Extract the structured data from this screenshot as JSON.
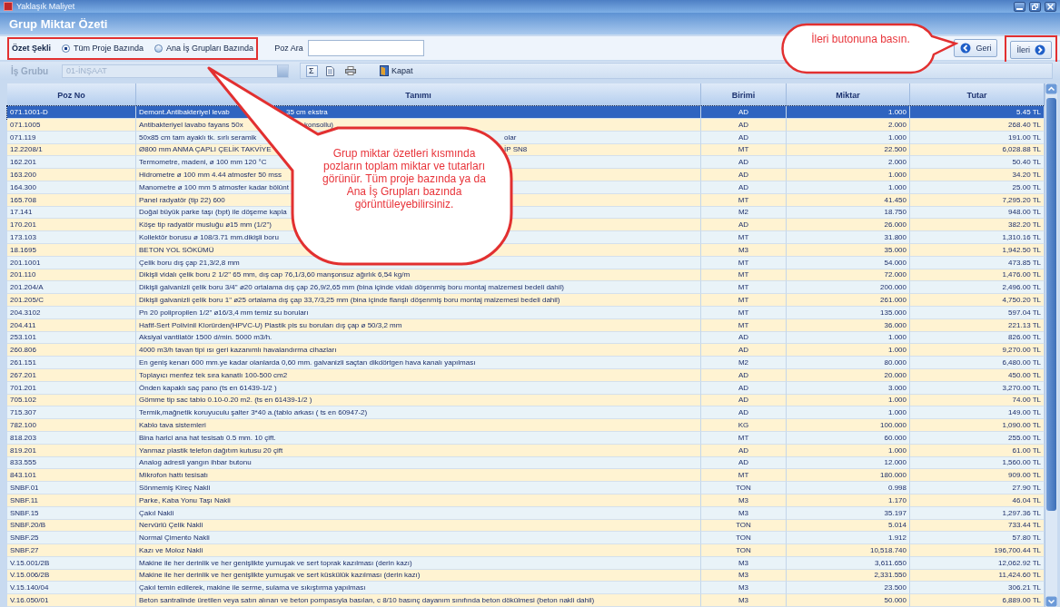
{
  "window": {
    "title": "Yaklaşık Maliyet"
  },
  "page_title": "Grup Miktar Özeti",
  "summary_mode": {
    "label": "Özet Şekli",
    "options": [
      {
        "label": "Tüm Proje Bazında",
        "selected": true
      },
      {
        "label": "Ana İş Grupları Bazında",
        "selected": false
      }
    ]
  },
  "search": {
    "label": "Poz Ara"
  },
  "nav_buttons": [
    {
      "label": "Geri",
      "kind": "back"
    },
    {
      "label": "İleri",
      "kind": "next"
    }
  ],
  "work_group": {
    "label": "İş Grubu",
    "value": "01-İNŞAAT",
    "disabled": true
  },
  "toolbar": [
    {
      "kind": "sum",
      "label": "Σ"
    },
    {
      "kind": "document"
    },
    {
      "kind": "print"
    },
    {
      "kind": "close",
      "label": "Kapat"
    }
  ],
  "table": {
    "columns": [
      "Poz No",
      "Tanımı",
      "Birimi",
      "Miktar",
      "Tutar"
    ],
    "rows": [
      {
        "poz": "071.1001-D",
        "desc": "Demont.Antibakteriyel levab",
        "desc_tail": "35 cm ekstra",
        "unit": "AD",
        "qty": "1.000",
        "amount": "5.45 TL",
        "selected": true
      },
      {
        "poz": "071.1005",
        "desc": "Antibakteriyel lavabo fayans 50x",
        "desc_tail": "konsollu)",
        "unit": "AD",
        "qty": "2.000",
        "amount": "268.40 TL",
        "selected": false
      },
      {
        "poz": "071.119",
        "desc": "50x85 cm tam ayaklı tk. sırlı seramik",
        "desc_tail": "olar",
        "unit": "AD",
        "qty": "1.000",
        "amount": "191.00 TL",
        "selected": false
      },
      {
        "poz": "12.2208/1",
        "desc": "Ø800 mm ANMA ÇAPLI ÇELİK TAKVİYE",
        "desc_tail": "İP SN8",
        "unit": "MT",
        "qty": "22.500",
        "amount": "6,028.88 TL",
        "selected": false
      },
      {
        "poz": "162.201",
        "desc": "Termometre, madeni, ø 100 mm 120 °C",
        "unit": "AD",
        "qty": "2.000",
        "amount": "50.40 TL",
        "selected": false
      },
      {
        "poz": "163.200",
        "desc": "Hidrometre ø 100 mm 4.44 atmosfer 50 mss",
        "unit": "AD",
        "qty": "1.000",
        "amount": "34.20 TL",
        "selected": false
      },
      {
        "poz": "164.300",
        "desc": "Manometre ø 100 mm 5 atmosfer kadar bölünt",
        "unit": "AD",
        "qty": "1.000",
        "amount": "25.00 TL",
        "selected": false
      },
      {
        "poz": "165.708",
        "desc": "Panel radyatör (tip 22) 600",
        "unit": "MT",
        "qty": "41.450",
        "amount": "7,295.20 TL",
        "selected": false
      },
      {
        "poz": "17.141",
        "desc": "Doğal büyük parke taşı (bpt) ile döşeme kapla",
        "unit": "M2",
        "qty": "18.750",
        "amount": "948.00 TL",
        "selected": false
      },
      {
        "poz": "170.201",
        "desc": "Köşe tip radyatör musluğu  ø15 mm (1/2\")",
        "unit": "AD",
        "qty": "26.000",
        "amount": "382.20 TL",
        "selected": false
      },
      {
        "poz": "173.103",
        "desc": "Kollektör borusu ø 108/3.71 mm.dikişli boru",
        "unit": "MT",
        "qty": "31.800",
        "amount": "1,310.16 TL",
        "selected": false
      },
      {
        "poz": "18.1695",
        "desc": "BETON YOL SÖKÜMÜ",
        "unit": "M3",
        "qty": "35.000",
        "amount": "1,942.50 TL",
        "selected": false
      },
      {
        "poz": "201.1001",
        "desc": "Çelik boru dış çap 21,3/2,8 mm",
        "unit": "MT",
        "qty": "54.000",
        "amount": "473.85 TL",
        "selected": false
      },
      {
        "poz": "201.110",
        "desc": "Dikişli vidalı çelik boru 2 1/2\" 65 mm, dış cap 76,1/3,60 manşonsuz ağırlık 6,54 kg/m",
        "unit": "MT",
        "qty": "72.000",
        "amount": "1,476.00 TL",
        "selected": false
      },
      {
        "poz": "201.204/A",
        "desc": "Dikişli galvanizli çelik boru 3/4\"  ø20 ortalama dış çap 26,9/2,65 mm  (bina içinde vidalı döşenmiş boru montaj malzemesi bedeli dahil)",
        "unit": "MT",
        "qty": "200.000",
        "amount": "2,496.00 TL",
        "selected": false
      },
      {
        "poz": "201.205/C",
        "desc": "Dikişli galvanizli çelik boru 1\"  ø25 ortalama dış çap 33,7/3,25 mm  (bina içinde flanşlı döşenmiş boru montaj malzemesi bedeli dahil)",
        "unit": "MT",
        "qty": "261.000",
        "amount": "4,750.20 TL",
        "selected": false
      },
      {
        "poz": "204.3102",
        "desc": "Pn 20 polipropilen 1/2\" ø16/3,4 mm temiz su boruları",
        "unit": "MT",
        "qty": "135.000",
        "amount": "597.04 TL",
        "selected": false
      },
      {
        "poz": "204.411",
        "desc": "Hafif-Sert Polivinil Klorürden(HPVC-U) Plastik pis su boruları dış çap ø 50/3,2 mm",
        "unit": "MT",
        "qty": "36.000",
        "amount": "221.13 TL",
        "selected": false
      },
      {
        "poz": "253.101",
        "desc": "Aksiyal vantilatör 1500 d/min. 5000 m3/h.",
        "unit": "AD",
        "qty": "1.000",
        "amount": "826.00 TL",
        "selected": false
      },
      {
        "poz": "260.806",
        "desc": "4000 m3/h tavan tipi ısı geri kazanımlı havalandırma cihazları",
        "unit": "AD",
        "qty": "1.000",
        "amount": "9,270.00 TL",
        "selected": false
      },
      {
        "poz": "261.151",
        "desc": "En geniş kenarı 600 mm.ye kadar olanlarda 0,60 mm. galvanizli saçtan dikdörtgen hava kanalı yapılması",
        "unit": "M2",
        "qty": "80.000",
        "amount": "6,480.00 TL",
        "selected": false
      },
      {
        "poz": "267.201",
        "desc": "Toplayıcı menfez tek sıra kanatlı 100-500 cm2",
        "unit": "AD",
        "qty": "20.000",
        "amount": "450.00 TL",
        "selected": false
      },
      {
        "poz": "701.201",
        "desc": "Önden kapaklı saç pano (ts en 61439-1/2 )",
        "unit": "AD",
        "qty": "3.000",
        "amount": "3,270.00 TL",
        "selected": false
      },
      {
        "poz": "705.102",
        "desc": "Gömme tip sac tablo 0.10-0.20 m2. (ts en 61439-1/2 )",
        "unit": "AD",
        "qty": "1.000",
        "amount": "74.00 TL",
        "selected": false
      },
      {
        "poz": "715.307",
        "desc": "Termik,mağnetik koruyuculu şalter 3*40 a.(tablo arkası ( ts en 60947-2)",
        "unit": "AD",
        "qty": "1.000",
        "amount": "149.00 TL",
        "selected": false
      },
      {
        "poz": "782.100",
        "desc": "Kablo tava sistemleri",
        "unit": "KG",
        "qty": "100.000",
        "amount": "1,090.00 TL",
        "selected": false
      },
      {
        "poz": "818.203",
        "desc": "Bina harici ana hat tesisatı 0.5 mm. 10 çift.",
        "unit": "MT",
        "qty": "60.000",
        "amount": "255.00 TL",
        "selected": false
      },
      {
        "poz": "819.201",
        "desc": "Yanmaz plastik telefon dağıtım kutusu 20 çift",
        "unit": "AD",
        "qty": "1.000",
        "amount": "61.00 TL",
        "selected": false
      },
      {
        "poz": "833.555",
        "desc": "Analog adresli yangın ihbar butonu",
        "unit": "AD",
        "qty": "12.000",
        "amount": "1,560.00 TL",
        "selected": false
      },
      {
        "poz": "843.101",
        "desc": "Mikrofon hattı tesisatı",
        "unit": "MT",
        "qty": "180.000",
        "amount": "909.00 TL",
        "selected": false
      },
      {
        "poz": "SNBF.01",
        "desc": "Sönmemiş Kireç Nakli",
        "unit": "TON",
        "qty": "0.998",
        "amount": "27.90 TL",
        "selected": false
      },
      {
        "poz": "SNBF.11",
        "desc": "Parke, Kaba Yonu Taşı Nakli",
        "unit": "M3",
        "qty": "1.170",
        "amount": "46.04 TL",
        "selected": false
      },
      {
        "poz": "SNBF.15",
        "desc": "Çakıl Nakli",
        "unit": "M3",
        "qty": "35.197",
        "amount": "1,297.36 TL",
        "selected": false
      },
      {
        "poz": "SNBF.20/B",
        "desc": "Nervürlü Çelik Nakli",
        "unit": "TON",
        "qty": "5.014",
        "amount": "733.44 TL",
        "selected": false
      },
      {
        "poz": "SNBF.25",
        "desc": "Normal Çimento Nakli",
        "unit": "TON",
        "qty": "1.912",
        "amount": "57.80 TL",
        "selected": false
      },
      {
        "poz": "SNBF.27",
        "desc": "Kazı ve Moloz Nakli",
        "unit": "TON",
        "qty": "10,518.740",
        "amount": "196,700.44 TL",
        "selected": false
      },
      {
        "poz": "V.15.001/2B",
        "desc": "Makine ile her derinlik ve her genişlikte yumuşak ve sert toprak kazılması (derin kazı)",
        "unit": "M3",
        "qty": "3,611.650",
        "amount": "12,062.92 TL",
        "selected": false
      },
      {
        "poz": "V.15.006/2B",
        "desc": "Makine ile her derinlik ve her genişlikte yumuşak ve sert küskülük kazılması (derin kazı)",
        "unit": "M3",
        "qty": "2,331.550",
        "amount": "11,424.60 TL",
        "selected": false
      },
      {
        "poz": "V.15.140/04",
        "desc": "Çakıl temin edilerek, makine ile serme, sulama ve sıkıştırma yapılması",
        "unit": "M3",
        "qty": "23.500",
        "amount": "306.21 TL",
        "selected": false
      },
      {
        "poz": "V.16.050/01",
        "desc": "Beton santralinde üretilen veya satın alınan ve beton pompasıyla basılan, c 8/10 basınç dayanım sınıfında beton dökülmesi (beton nakli dahil)",
        "unit": "M3",
        "qty": "50.000",
        "amount": "6,889.00 TL",
        "selected": false
      }
    ]
  },
  "callouts": [
    {
      "text": "İleri butonuna basın."
    },
    {
      "text": "Grup miktar özetleri kısmında pozların toplam miktar ve tutarları görünür. Tüm proje bazında ya da Ana İş Grupları bazında görüntüleyebilirsiniz."
    }
  ]
}
